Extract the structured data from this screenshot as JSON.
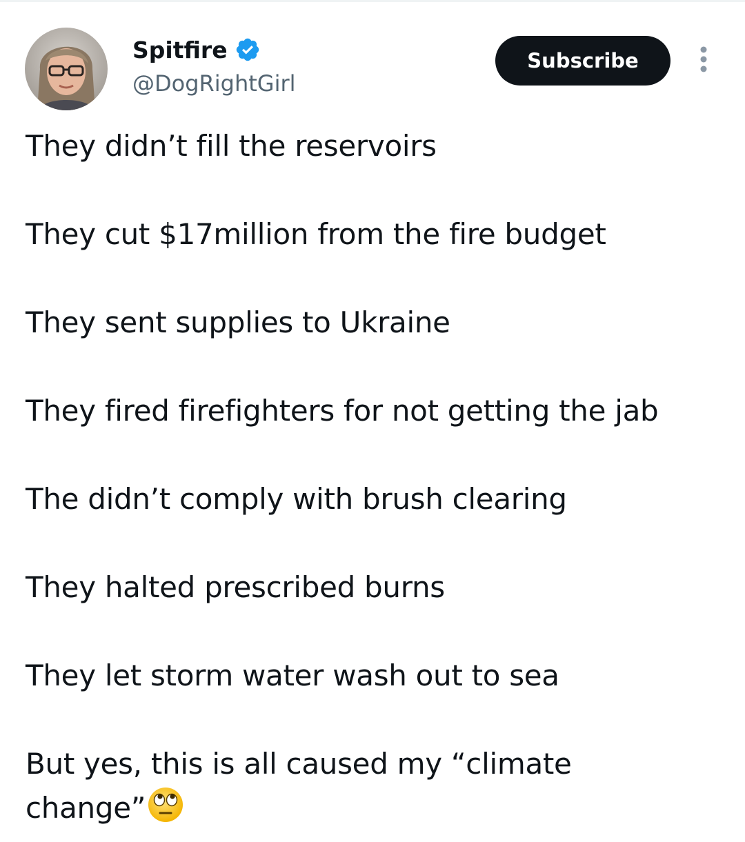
{
  "author": {
    "display_name": "Spitfire",
    "handle": "@DogRightGirl",
    "verified": true,
    "verified_icon": "verified-badge-icon",
    "avatar_icon": "profile-photo"
  },
  "actions": {
    "subscribe_label": "Subscribe",
    "more_icon": "more-vertical-icon"
  },
  "tweet": {
    "lines": [
      "They didn’t fill the reservoirs",
      "They cut $17million from the fire budget",
      "They sent supplies to Ukraine",
      "They fired firefighters for not getting the jab",
      "The didn’t comply with brush clearing",
      "They halted prescribed burns",
      "They let storm water wash out to sea"
    ],
    "last_line": "But yes, this is all caused my “climate change”",
    "emoji": "eye-roll-emoji"
  },
  "colors": {
    "text": "#0f1419",
    "secondary_text": "#536471",
    "verified_blue": "#1d9bf0",
    "button_bg": "#0f1419",
    "button_text": "#ffffff"
  }
}
